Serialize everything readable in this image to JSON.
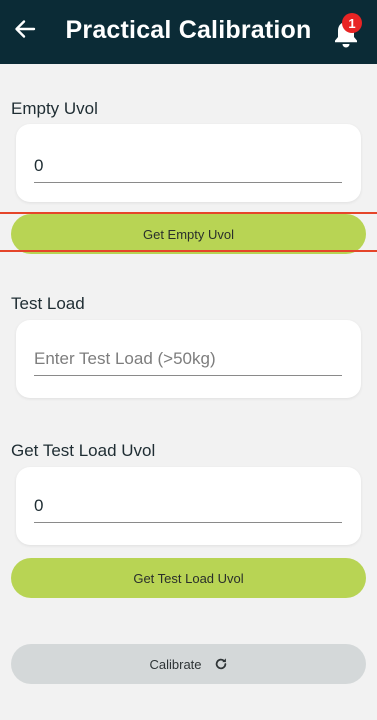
{
  "header": {
    "title": "Practical Calibration",
    "notification_count": "1",
    "background_color": "#0b2b36"
  },
  "empty_uvol": {
    "label": "Empty Uvol",
    "value": "0",
    "button_label": "Get Empty Uvol"
  },
  "test_load": {
    "label": "Test Load",
    "placeholder": "Enter Test Load (>50kg)",
    "value": ""
  },
  "test_load_uvol": {
    "label": "Get Test Load Uvol",
    "value": "0",
    "button_label": "Get Test Load Uvol"
  },
  "calibrate": {
    "button_label": "Calibrate",
    "icon": "refresh-icon"
  },
  "colors": {
    "accent_green": "#b8d454",
    "disabled_grey": "#d4d8d9",
    "badge_red": "#e82424",
    "highlight": "#e5452a"
  }
}
